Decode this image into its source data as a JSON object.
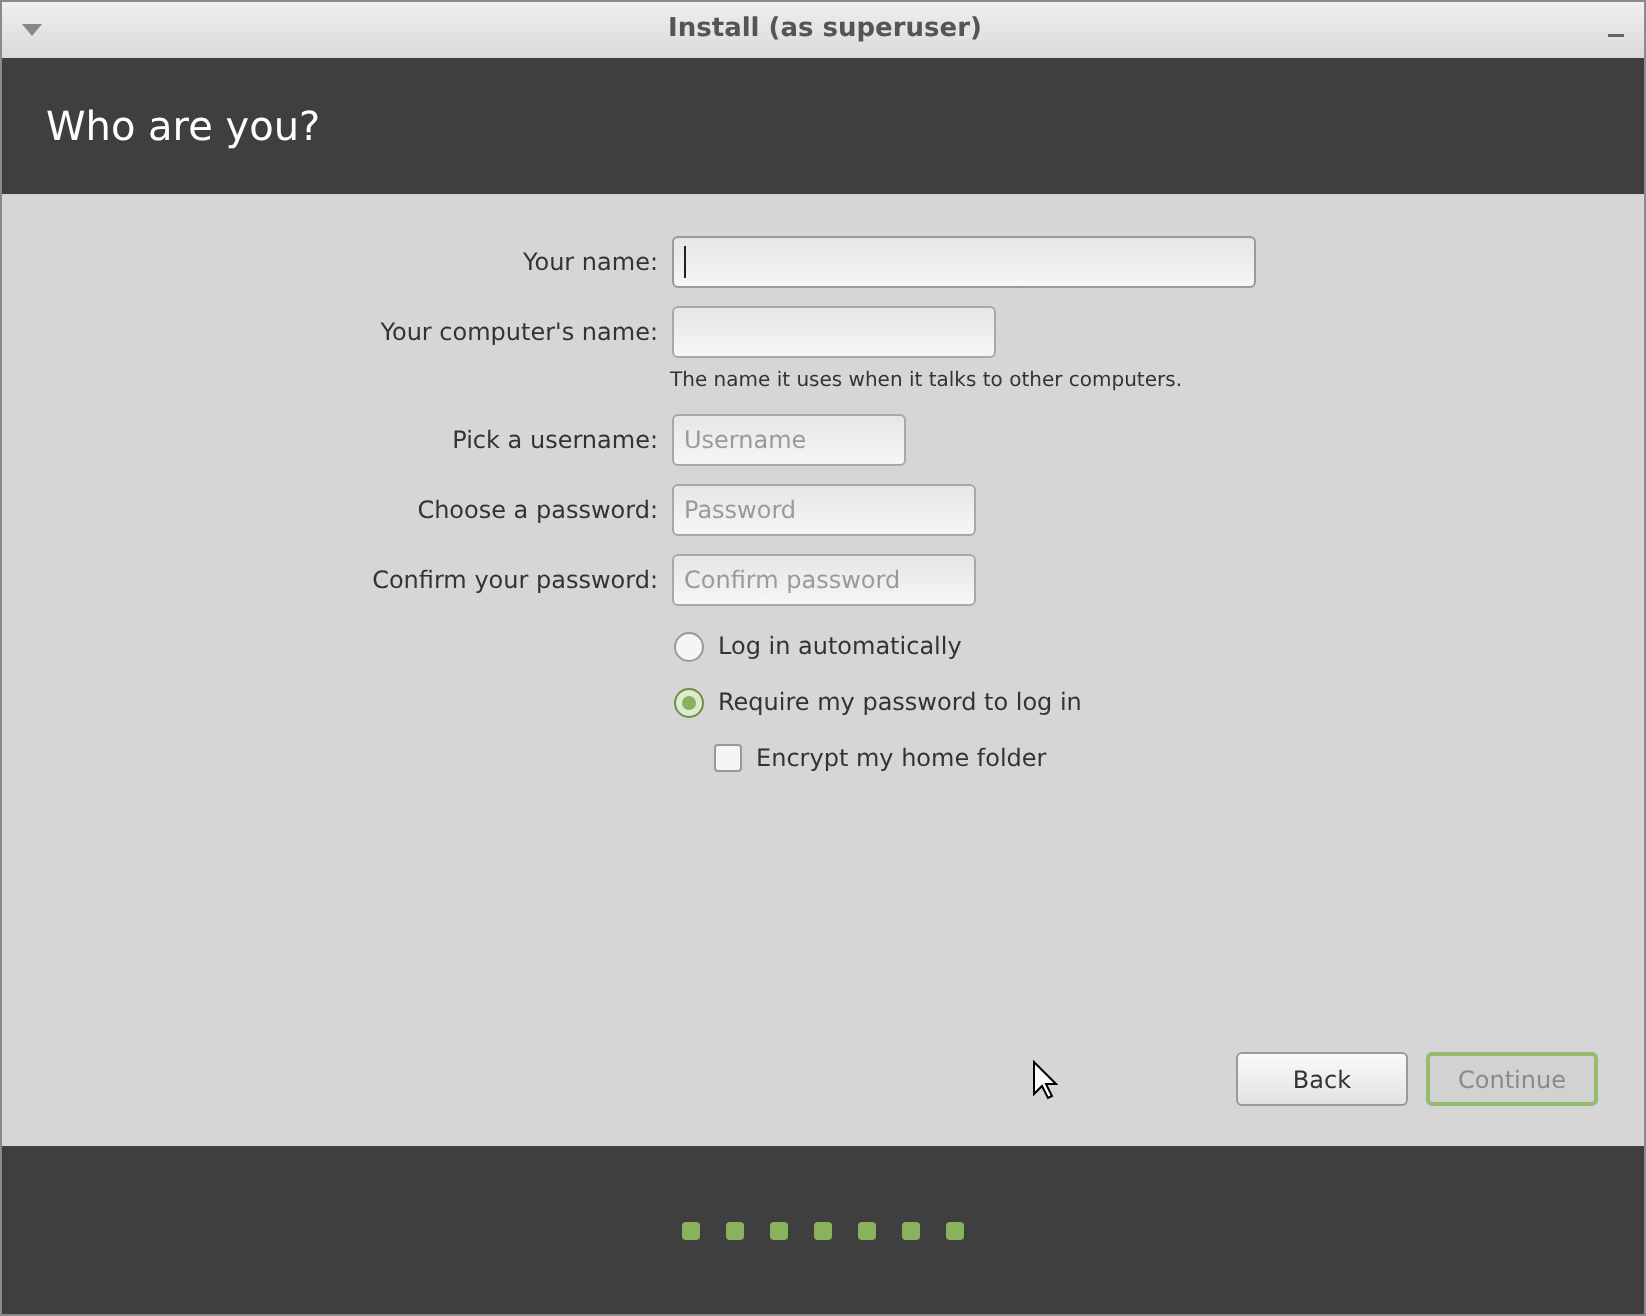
{
  "window": {
    "title": "Install (as superuser)"
  },
  "header": {
    "title": "Who are you?"
  },
  "fields": [
    {
      "label": "Your name:",
      "focused": true
    },
    {
      "label": "Your computer's name:",
      "focused": false,
      "hint": "The name it uses when it talks to other computers."
    },
    {
      "label": "Pick a username:",
      "focused": false,
      "placeholder": "Username"
    },
    {
      "label": "Choose a password:",
      "focused": false,
      "placeholder": "Password"
    },
    {
      "label": "Confirm your password:",
      "focused": false,
      "placeholder": "Confirm password"
    }
  ],
  "login_options": [
    {
      "label": "Log in automatically",
      "selected": false
    },
    {
      "label": "Require my password to log in",
      "selected": true
    }
  ],
  "encrypt": {
    "label": "Encrypt my home folder",
    "checked": false
  },
  "buttons": [
    {
      "label": "Back",
      "disabled": false,
      "focused": false
    },
    {
      "label": "Continue",
      "disabled": true,
      "focused": true
    }
  ],
  "progress_steps": [
    {
      "done": true
    },
    {
      "done": true
    },
    {
      "done": true
    },
    {
      "done": true
    },
    {
      "done": true
    },
    {
      "done": true
    },
    {
      "done": true
    }
  ]
}
